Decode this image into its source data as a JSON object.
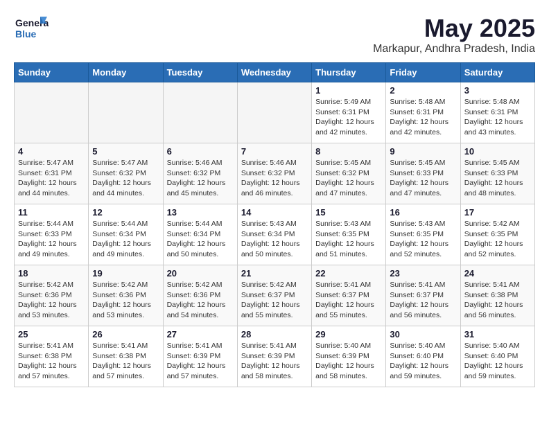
{
  "logo": {
    "line1": "General",
    "line2": "Blue"
  },
  "title": "May 2025",
  "subtitle": "Markapur, Andhra Pradesh, India",
  "day_headers": [
    "Sunday",
    "Monday",
    "Tuesday",
    "Wednesday",
    "Thursday",
    "Friday",
    "Saturday"
  ],
  "weeks": [
    [
      {
        "date": "",
        "text": ""
      },
      {
        "date": "",
        "text": ""
      },
      {
        "date": "",
        "text": ""
      },
      {
        "date": "",
        "text": ""
      },
      {
        "date": "1",
        "text": "Sunrise: 5:49 AM\nSunset: 6:31 PM\nDaylight: 12 hours and 42 minutes."
      },
      {
        "date": "2",
        "text": "Sunrise: 5:48 AM\nSunset: 6:31 PM\nDaylight: 12 hours and 42 minutes."
      },
      {
        "date": "3",
        "text": "Sunrise: 5:48 AM\nSunset: 6:31 PM\nDaylight: 12 hours and 43 minutes."
      }
    ],
    [
      {
        "date": "4",
        "text": "Sunrise: 5:47 AM\nSunset: 6:31 PM\nDaylight: 12 hours and 44 minutes."
      },
      {
        "date": "5",
        "text": "Sunrise: 5:47 AM\nSunset: 6:32 PM\nDaylight: 12 hours and 44 minutes."
      },
      {
        "date": "6",
        "text": "Sunrise: 5:46 AM\nSunset: 6:32 PM\nDaylight: 12 hours and 45 minutes."
      },
      {
        "date": "7",
        "text": "Sunrise: 5:46 AM\nSunset: 6:32 PM\nDaylight: 12 hours and 46 minutes."
      },
      {
        "date": "8",
        "text": "Sunrise: 5:45 AM\nSunset: 6:32 PM\nDaylight: 12 hours and 47 minutes."
      },
      {
        "date": "9",
        "text": "Sunrise: 5:45 AM\nSunset: 6:33 PM\nDaylight: 12 hours and 47 minutes."
      },
      {
        "date": "10",
        "text": "Sunrise: 5:45 AM\nSunset: 6:33 PM\nDaylight: 12 hours and 48 minutes."
      }
    ],
    [
      {
        "date": "11",
        "text": "Sunrise: 5:44 AM\nSunset: 6:33 PM\nDaylight: 12 hours and 49 minutes."
      },
      {
        "date": "12",
        "text": "Sunrise: 5:44 AM\nSunset: 6:34 PM\nDaylight: 12 hours and 49 minutes."
      },
      {
        "date": "13",
        "text": "Sunrise: 5:44 AM\nSunset: 6:34 PM\nDaylight: 12 hours and 50 minutes."
      },
      {
        "date": "14",
        "text": "Sunrise: 5:43 AM\nSunset: 6:34 PM\nDaylight: 12 hours and 50 minutes."
      },
      {
        "date": "15",
        "text": "Sunrise: 5:43 AM\nSunset: 6:35 PM\nDaylight: 12 hours and 51 minutes."
      },
      {
        "date": "16",
        "text": "Sunrise: 5:43 AM\nSunset: 6:35 PM\nDaylight: 12 hours and 52 minutes."
      },
      {
        "date": "17",
        "text": "Sunrise: 5:42 AM\nSunset: 6:35 PM\nDaylight: 12 hours and 52 minutes."
      }
    ],
    [
      {
        "date": "18",
        "text": "Sunrise: 5:42 AM\nSunset: 6:36 PM\nDaylight: 12 hours and 53 minutes."
      },
      {
        "date": "19",
        "text": "Sunrise: 5:42 AM\nSunset: 6:36 PM\nDaylight: 12 hours and 53 minutes."
      },
      {
        "date": "20",
        "text": "Sunrise: 5:42 AM\nSunset: 6:36 PM\nDaylight: 12 hours and 54 minutes."
      },
      {
        "date": "21",
        "text": "Sunrise: 5:42 AM\nSunset: 6:37 PM\nDaylight: 12 hours and 55 minutes."
      },
      {
        "date": "22",
        "text": "Sunrise: 5:41 AM\nSunset: 6:37 PM\nDaylight: 12 hours and 55 minutes."
      },
      {
        "date": "23",
        "text": "Sunrise: 5:41 AM\nSunset: 6:37 PM\nDaylight: 12 hours and 56 minutes."
      },
      {
        "date": "24",
        "text": "Sunrise: 5:41 AM\nSunset: 6:38 PM\nDaylight: 12 hours and 56 minutes."
      }
    ],
    [
      {
        "date": "25",
        "text": "Sunrise: 5:41 AM\nSunset: 6:38 PM\nDaylight: 12 hours and 57 minutes."
      },
      {
        "date": "26",
        "text": "Sunrise: 5:41 AM\nSunset: 6:38 PM\nDaylight: 12 hours and 57 minutes."
      },
      {
        "date": "27",
        "text": "Sunrise: 5:41 AM\nSunset: 6:39 PM\nDaylight: 12 hours and 57 minutes."
      },
      {
        "date": "28",
        "text": "Sunrise: 5:41 AM\nSunset: 6:39 PM\nDaylight: 12 hours and 58 minutes."
      },
      {
        "date": "29",
        "text": "Sunrise: 5:40 AM\nSunset: 6:39 PM\nDaylight: 12 hours and 58 minutes."
      },
      {
        "date": "30",
        "text": "Sunrise: 5:40 AM\nSunset: 6:40 PM\nDaylight: 12 hours and 59 minutes."
      },
      {
        "date": "31",
        "text": "Sunrise: 5:40 AM\nSunset: 6:40 PM\nDaylight: 12 hours and 59 minutes."
      }
    ]
  ]
}
